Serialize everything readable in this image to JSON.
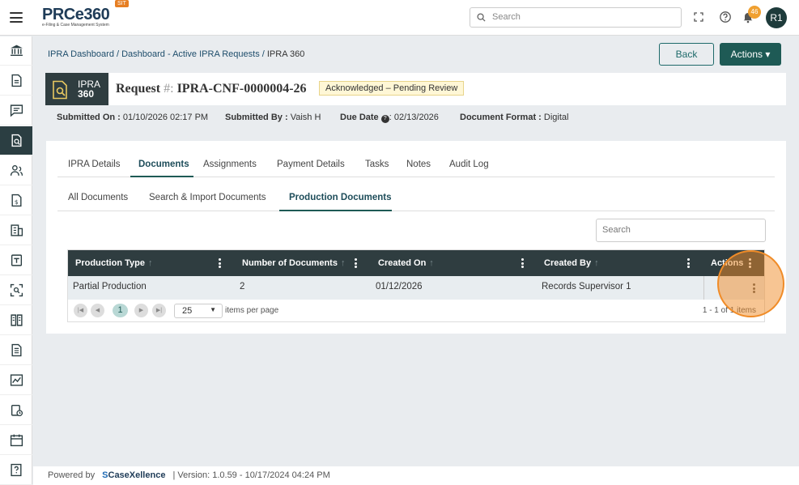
{
  "header": {
    "logo_text": "PRCe360",
    "logo_sub": "e-Filing & Case Management System",
    "env_badge": "SIT",
    "search_placeholder": "Search",
    "notif_count": "46",
    "avatar_initials": "R1"
  },
  "breadcrumb": {
    "items": [
      "IPRA Dashboard",
      "Dashboard - Active IPRA Requests"
    ],
    "current": "IPRA 360"
  },
  "buttons": {
    "back": "Back",
    "actions": "Actions ▾"
  },
  "request": {
    "badge_line1": "IPRA",
    "badge_line2": "360",
    "title_prefix": "Request",
    "title_hash": "#:",
    "id": "IPRA-CNF-0000004-26",
    "status": "Acknowledged – Pending Review"
  },
  "meta": {
    "submitted_on_label": "Submitted On :",
    "submitted_on": "01/10/2026 02:17 PM",
    "submitted_by_label": "Submitted By :",
    "submitted_by": "Vaish H",
    "due_date_label": "Due Date",
    "due_date": ": 02/13/2026",
    "doc_format_label": "Document Format :",
    "doc_format": "Digital"
  },
  "tabs": [
    "IPRA Details",
    "Documents",
    "Assignments",
    "Payment Details",
    "Tasks",
    "Notes",
    "Audit Log"
  ],
  "sub_tabs": [
    "All Documents",
    "Search & Import Documents",
    "Production Documents"
  ],
  "grid_search_placeholder": "Search",
  "grid": {
    "columns": [
      "Production Type",
      "Number of Documents",
      "Created On",
      "Created By",
      "Actions"
    ],
    "rows": [
      {
        "type": "Partial Production",
        "count": "2",
        "created_on": "01/12/2026",
        "created_by": "Records Supervisor 1"
      }
    ],
    "page": "1",
    "page_size": "25",
    "items_per_page": "items per page",
    "count_text": "1 - 1 of 1 items"
  },
  "footer": {
    "powered": "Powered by",
    "brand": "CaseXellence",
    "version": "|  Version: 1.0.59 - 10/17/2024 04:24 PM"
  }
}
